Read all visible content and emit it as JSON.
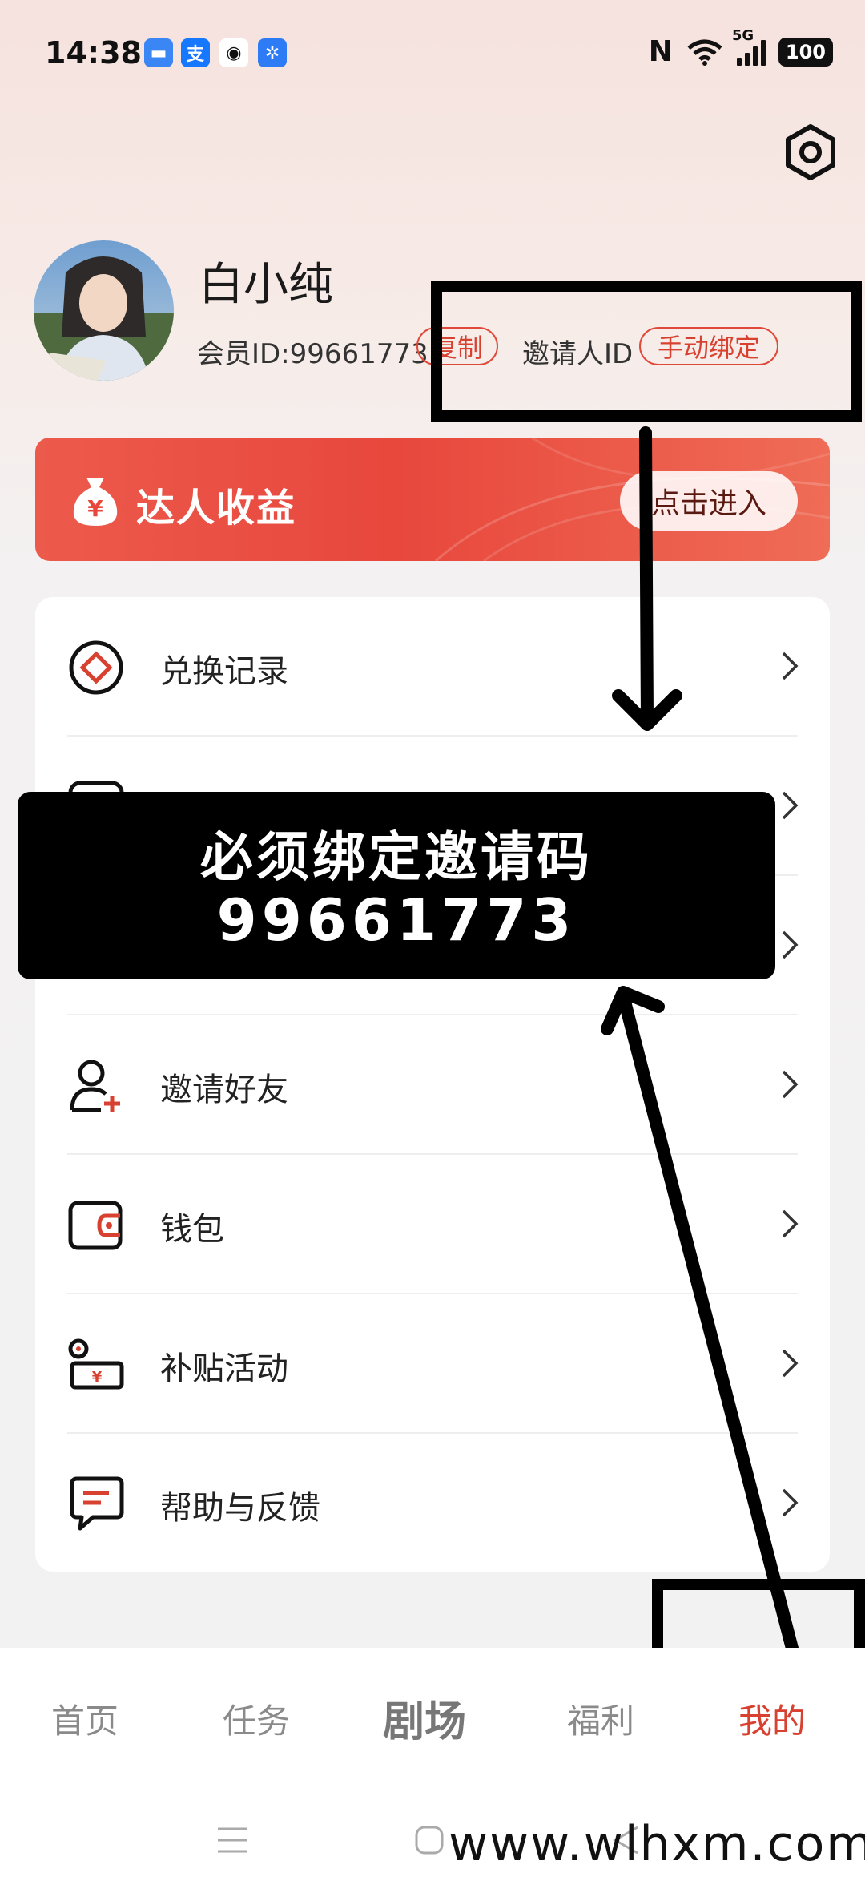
{
  "status_bar": {
    "time": "14:38",
    "network": "5G",
    "battery": "100",
    "notification_icons": [
      "message-icon",
      "alipay-icon",
      "qq-icon",
      "pinwheel-icon"
    ]
  },
  "profile": {
    "name": "白小纯",
    "member_id_label": "会员ID:99661773",
    "copy_label": "复制",
    "inviter_label": "邀请人ID",
    "bind_label": "手动绑定"
  },
  "banner": {
    "title": "达人收益",
    "button": "点击进入",
    "icon_glyph": "¥"
  },
  "menu": {
    "items": [
      {
        "label": "兑换记录",
        "icon": "exchange-record-icon"
      },
      {
        "label": "",
        "icon": "hidden-item-icon"
      },
      {
        "label": "",
        "icon": "hidden-item-icon"
      },
      {
        "label": "邀请好友",
        "icon": "invite-friend-icon"
      },
      {
        "label": "钱包",
        "icon": "wallet-icon"
      },
      {
        "label": "补贴活动",
        "icon": "subsidy-icon"
      },
      {
        "label": "帮助与反馈",
        "icon": "feedback-icon"
      }
    ]
  },
  "overlay": {
    "line1": "必须绑定邀请码",
    "line2": "99661773"
  },
  "tabs": [
    {
      "label": "首页"
    },
    {
      "label": "任务"
    },
    {
      "label": "剧场"
    },
    {
      "label": "福利"
    },
    {
      "label": "我的"
    }
  ],
  "watermark": "www.wlhxm.com",
  "colors": {
    "accent": "#d8402f",
    "banner": "#e8473c"
  }
}
